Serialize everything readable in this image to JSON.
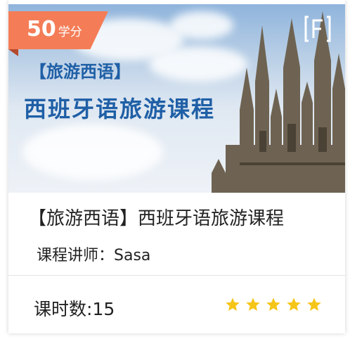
{
  "banner": {
    "credits_value": "50",
    "credits_unit": "学分",
    "tag": "【旅游西语】",
    "title": "西班牙语旅游课程",
    "logo_icon": "framed-letter-f-icon",
    "badge_color": "#f47d57",
    "title_color": "#1f5fa6"
  },
  "course": {
    "name": "【旅游西语】西班牙语旅游课程",
    "teacher_label": "课程讲师：",
    "teacher_name": "Sasa",
    "lessons_label": "课时数:",
    "lessons_count": "15",
    "rating": 5,
    "rating_max": 5,
    "star_color": "#f5c518"
  }
}
